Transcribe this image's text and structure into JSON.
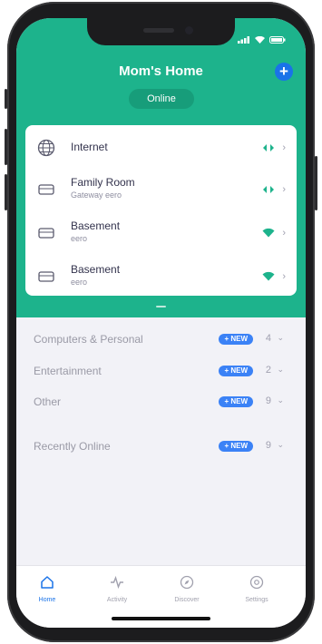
{
  "header": {
    "title": "Mom's Home",
    "status": "Online",
    "add_icon": "plus-icon",
    "bg_color": "#1db38c"
  },
  "devices": [
    {
      "name": "Internet",
      "sub": "",
      "icon": "globe-icon",
      "signal_icon": "connection-arrows-icon"
    },
    {
      "name": "Family Room",
      "sub": "Gateway eero",
      "icon": "eero-device-icon",
      "signal_icon": "connection-arrows-icon"
    },
    {
      "name": "Basement",
      "sub": "eero",
      "icon": "eero-device-icon",
      "signal_icon": "wifi-icon"
    },
    {
      "name": "Basement",
      "sub": "eero",
      "icon": "eero-device-icon",
      "signal_icon": "wifi-icon"
    }
  ],
  "categories": [
    {
      "label": "Computers & Personal",
      "badge": "+ NEW",
      "count": "4"
    },
    {
      "label": "Entertainment",
      "badge": "+ NEW",
      "count": "2"
    },
    {
      "label": "Other",
      "badge": "+ NEW",
      "count": "9"
    },
    {
      "label": "Recently Online",
      "badge": "+ NEW",
      "count": "9"
    }
  ],
  "tabs": [
    {
      "label": "Home",
      "icon": "home-icon",
      "active": true
    },
    {
      "label": "Activity",
      "icon": "activity-icon",
      "active": false
    },
    {
      "label": "Discover",
      "icon": "compass-icon",
      "active": false
    },
    {
      "label": "Settings",
      "icon": "gear-icon",
      "active": false
    }
  ]
}
